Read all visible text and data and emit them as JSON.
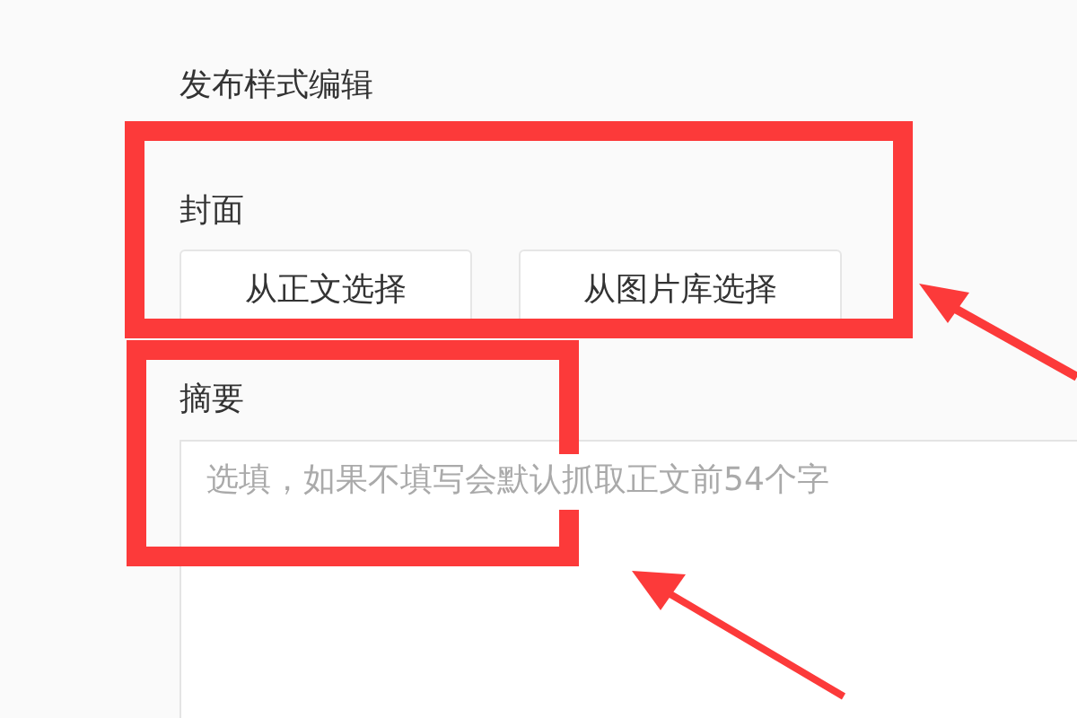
{
  "title": "发布样式编辑",
  "cover": {
    "label": "封面",
    "buttons": [
      "从正文选择",
      "从图片库选择"
    ]
  },
  "summary": {
    "label": "摘要",
    "placeholder": "选填，如果不填写会默认抓取正文前54个字"
  }
}
